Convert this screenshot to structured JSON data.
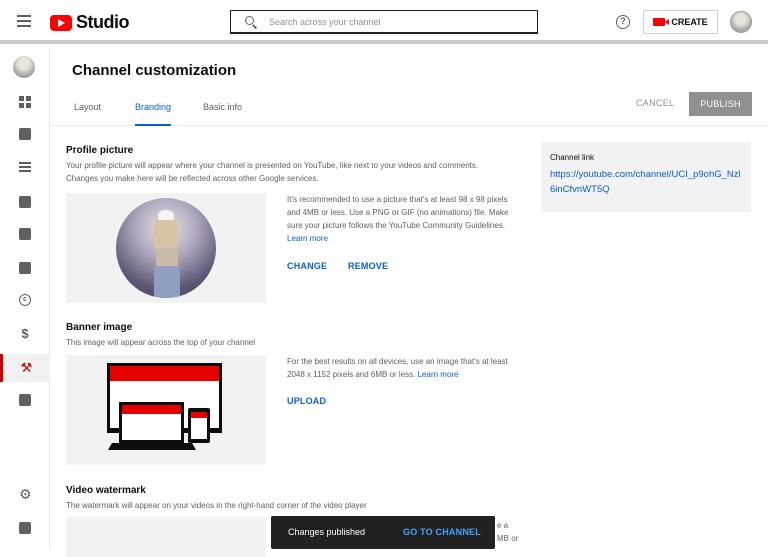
{
  "topbar": {
    "logo_text": "Studio",
    "search_placeholder": "Search across your channel",
    "help_glyph": "?",
    "create_label": "CREATE"
  },
  "sidebar": {
    "items": [
      {
        "icon": "dashboard-icon"
      },
      {
        "icon": "content-icon"
      },
      {
        "icon": "playlists-icon"
      },
      {
        "icon": "analytics-icon"
      },
      {
        "icon": "comments-icon"
      },
      {
        "icon": "subtitles-icon"
      },
      {
        "icon": "copyright-icon"
      },
      {
        "icon": "monetization-icon"
      },
      {
        "icon": "customization-icon",
        "active": true
      },
      {
        "icon": "audio-library-icon"
      },
      {
        "icon": "settings-icon"
      },
      {
        "icon": "feedback-icon"
      }
    ]
  },
  "page": {
    "title": "Channel customization",
    "tabs": [
      "Layout",
      "Branding",
      "Basic info"
    ],
    "active_tab": "Branding",
    "cancel_label": "CANCEL",
    "publish_label": "PUBLISH"
  },
  "profile": {
    "title": "Profile picture",
    "desc": "Your profile picture will appear where your channel is presented on YouTube, like next to your videos and comments. Changes you make here will be reflected across other Google services.",
    "hint": "It's recommended to use a picture that's at least 98 x 98 pixels and 4MB or less. Use a PNG or GIF (no animations) file. Make sure your picture follows the YouTube Community Guidelines.",
    "learn_more": "Learn more",
    "change_label": "CHANGE",
    "remove_label": "REMOVE"
  },
  "banner": {
    "title": "Banner image",
    "desc": "This image will appear across the top of your channel",
    "hint": "For the best results on all devices, use an image that's at least 2048 x 1152 pixels and 6MB or less.",
    "learn_more": "Learn more",
    "upload_label": "UPLOAD"
  },
  "watermark": {
    "title": "Video watermark",
    "desc": "The watermark will appear on your videos in the right-hand corner of the video player",
    "hint_fragment_1": "e a",
    "hint_fragment_2": "MB or"
  },
  "channel_link": {
    "label": "Channel link",
    "url": "https://youtube.com/channel/UCI_p9ohG_Nzl6inCfvnWT5Q"
  },
  "toast": {
    "message": "Changes published",
    "action": "GO TO CHANNEL"
  },
  "colors": {
    "accent": "#065fd4",
    "brand_red": "#ff0000",
    "publish_disabled": "#909090"
  }
}
